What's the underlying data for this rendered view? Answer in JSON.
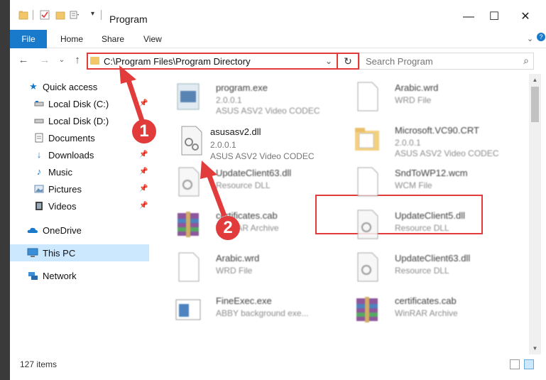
{
  "window": {
    "title": "Program"
  },
  "ribbon": {
    "tabs": [
      {
        "label": "File"
      },
      {
        "label": "Home"
      },
      {
        "label": "Share"
      },
      {
        "label": "View"
      }
    ]
  },
  "address": {
    "path": "C:\\Program Files\\Program Directory"
  },
  "search": {
    "placeholder": "Search Program"
  },
  "sidebar": {
    "items": [
      {
        "label": "Quick access",
        "icon": "star-icon"
      },
      {
        "label": "Local Disk (C:)",
        "icon": "drive-icon"
      },
      {
        "label": "Local Disk (D:)",
        "icon": "drive-icon"
      },
      {
        "label": "Documents",
        "icon": "documents-icon"
      },
      {
        "label": "Downloads",
        "icon": "download-icon"
      },
      {
        "label": "Music",
        "icon": "music-icon"
      },
      {
        "label": "Pictures",
        "icon": "pictures-icon"
      },
      {
        "label": "Videos",
        "icon": "videos-icon"
      },
      {
        "label": "OneDrive",
        "icon": "cloud-icon"
      },
      {
        "label": "This PC",
        "icon": "computer-icon"
      },
      {
        "label": "Network",
        "icon": "network-icon"
      }
    ]
  },
  "files": {
    "left": [
      {
        "name": "program.exe",
        "line2": "2.0.0.1",
        "line3": "ASUS ASV2 Video CODEC",
        "icon": "exe-icon"
      },
      {
        "name": "asusasv2.dll",
        "line2": "2.0.0.1",
        "line3": "ASUS ASV2 Video CODEC",
        "icon": "dll-icon"
      },
      {
        "name": "UpdateClient63.dll",
        "line2": "Resource DLL",
        "line3": "",
        "icon": "dll-icon"
      },
      {
        "name": "certificates.cab",
        "line2": "WinRAR Archive",
        "line3": "",
        "icon": "archive-icon"
      },
      {
        "name": "Arabic.wrd",
        "line2": "WRD File",
        "line3": "",
        "icon": "file-icon"
      },
      {
        "name": "FineExec.exe",
        "line2": "ABBY background exe...",
        "line3": "",
        "icon": "exe-icon"
      }
    ],
    "right": [
      {
        "name": "Arabic.wrd",
        "line2": "WRD File",
        "line3": "",
        "icon": "file-icon"
      },
      {
        "name": "Microsoft.VC90.CRT",
        "line2": "2.0.0.1",
        "line3": "ASUS ASV2 Video CODEC",
        "icon": "folder-icon"
      },
      {
        "name": "SndToWP12.wcm",
        "line2": "WCM File",
        "line3": "",
        "icon": "file-icon"
      },
      {
        "name": "UpdateClient5.dll",
        "line2": "Resource DLL",
        "line3": "",
        "icon": "dll-icon"
      },
      {
        "name": "UpdateClient63.dll",
        "line2": "Resource DLL",
        "line3": "",
        "icon": "dll-icon"
      },
      {
        "name": "certificates.cab",
        "line2": "WinRAR Archive",
        "line3": "",
        "icon": "archive-icon"
      }
    ]
  },
  "status": {
    "count": "127 items"
  },
  "callouts": {
    "one": "1",
    "two": "2"
  },
  "colors": {
    "accent": "#1979ca",
    "highlight": "#e23b3b",
    "selected": "#cce8ff"
  }
}
